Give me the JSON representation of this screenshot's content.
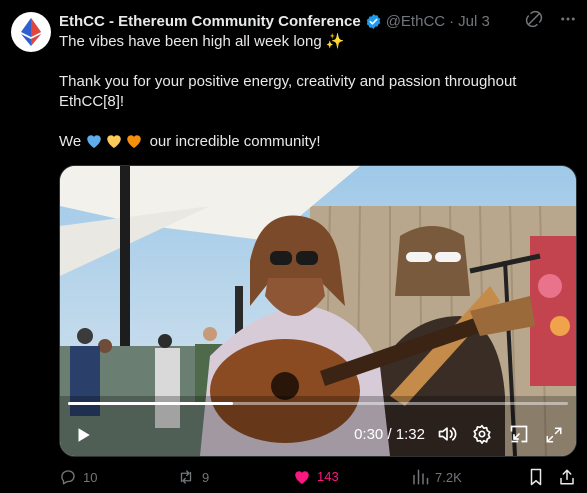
{
  "author": {
    "name": "EthCC - Ethereum Community Conference",
    "handle": "@EthCC",
    "separator": "·",
    "date": "Jul 3"
  },
  "tweet": {
    "line1": "The vibes have been high all week long ✨",
    "line2": "Thank you for your positive energy, creativity and passion throughout EthCC[8]!",
    "line3_prefix": "We",
    "line3_suffix": "our incredible community!",
    "hearts": [
      "blue-heart",
      "yellow-heart",
      "orange-heart"
    ]
  },
  "video": {
    "current_time": "0:30",
    "time_separator": "/",
    "duration": "1:32",
    "progress": 0.33
  },
  "actions": {
    "replies": "10",
    "reposts": "9",
    "likes": "143",
    "views": "7.2K"
  },
  "colors": {
    "accent": "#1d9bf0",
    "like": "#f91880",
    "muted": "#71767b"
  }
}
